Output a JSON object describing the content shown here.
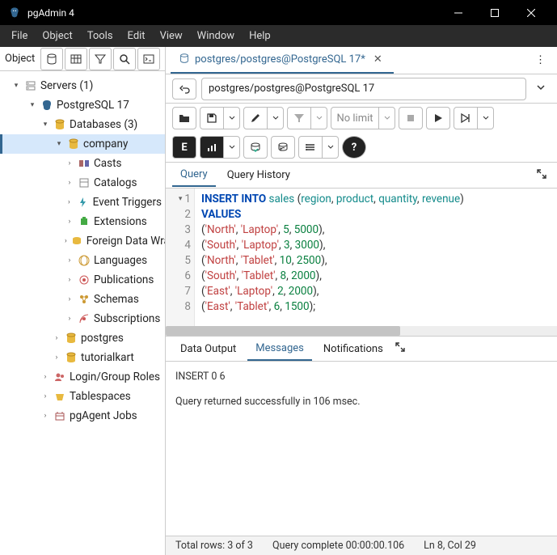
{
  "title_bar": {
    "app_title": "pgAdmin 4"
  },
  "menu": [
    "File",
    "Object",
    "Tools",
    "Edit",
    "View",
    "Window",
    "Help"
  ],
  "sidebar": {
    "header_label": "Object",
    "tree": [
      {
        "indent": 14,
        "open": true,
        "icon": "servers",
        "label": "Servers (1)"
      },
      {
        "indent": 34,
        "open": true,
        "icon": "pg",
        "label": "PostgreSQL 17"
      },
      {
        "indent": 50,
        "open": true,
        "icon": "db-group",
        "label": "Databases (3)"
      },
      {
        "indent": 64,
        "open": true,
        "icon": "db",
        "label": "company",
        "selected": true
      },
      {
        "indent": 80,
        "open": false,
        "icon": "casts",
        "label": "Casts"
      },
      {
        "indent": 80,
        "open": false,
        "icon": "catalogs",
        "label": "Catalogs"
      },
      {
        "indent": 80,
        "open": false,
        "icon": "triggers",
        "label": "Event Triggers"
      },
      {
        "indent": 80,
        "open": false,
        "icon": "ext",
        "label": "Extensions"
      },
      {
        "indent": 80,
        "open": false,
        "icon": "fdw",
        "label": "Foreign Data Wrappers"
      },
      {
        "indent": 80,
        "open": false,
        "icon": "lang",
        "label": "Languages"
      },
      {
        "indent": 80,
        "open": false,
        "icon": "pub",
        "label": "Publications"
      },
      {
        "indent": 80,
        "open": false,
        "icon": "schema",
        "label": "Schemas"
      },
      {
        "indent": 80,
        "open": false,
        "icon": "sub",
        "label": "Subscriptions"
      },
      {
        "indent": 64,
        "open": false,
        "icon": "db",
        "label": "postgres"
      },
      {
        "indent": 64,
        "open": false,
        "icon": "db",
        "label": "tutorialkart"
      },
      {
        "indent": 50,
        "open": false,
        "icon": "roles",
        "label": "Login/Group Roles"
      },
      {
        "indent": 50,
        "open": false,
        "icon": "ts",
        "label": "Tablespaces"
      },
      {
        "indent": 50,
        "open": false,
        "icon": "agent",
        "label": "pgAgent Jobs"
      }
    ]
  },
  "query_tab": {
    "label": "postgres/postgres@PostgreSQL 17*"
  },
  "connection": {
    "value": "postgres/postgres@PostgreSQL 17"
  },
  "toolbar": {
    "limit": "No limit"
  },
  "editor_tabs": {
    "query": "Query",
    "history": "Query History"
  },
  "editor": {
    "lines": [
      1,
      2,
      3,
      4,
      5,
      6,
      7,
      8
    ],
    "sql": {
      "l1_kw1": "INSERT",
      "l1_kw2": "INTO",
      "l1_tbl": "sales",
      "l1_c1": "region",
      "l1_c2": "product",
      "l1_c3": "quantity",
      "l1_c4": "revenue",
      "l2_kw": "VALUES",
      "rows": [
        {
          "region": "'North'",
          "product": "'Laptop'",
          "qty": "5",
          "rev": "5000"
        },
        {
          "region": "'South'",
          "product": "'Laptop'",
          "qty": "3",
          "rev": "3000"
        },
        {
          "region": "'North'",
          "product": "'Tablet'",
          "qty": "10",
          "rev": "2500"
        },
        {
          "region": "'South'",
          "product": "'Tablet'",
          "qty": "8",
          "rev": "2000"
        },
        {
          "region": "'East'",
          "product": "'Laptop'",
          "qty": "2",
          "rev": "2000"
        },
        {
          "region": "'East'",
          "product": "'Tablet'",
          "qty": "6",
          "rev": "1500"
        }
      ]
    }
  },
  "results_tabs": {
    "data": "Data Output",
    "messages": "Messages",
    "notifications": "Notifications"
  },
  "messages": {
    "line1": "INSERT 0 6",
    "line2": "Query returned successfully in 106 msec."
  },
  "status": {
    "rows": "Total rows: 3 of 3",
    "time": "Query complete 00:00:00.106",
    "cursor": "Ln 8, Col 29"
  }
}
